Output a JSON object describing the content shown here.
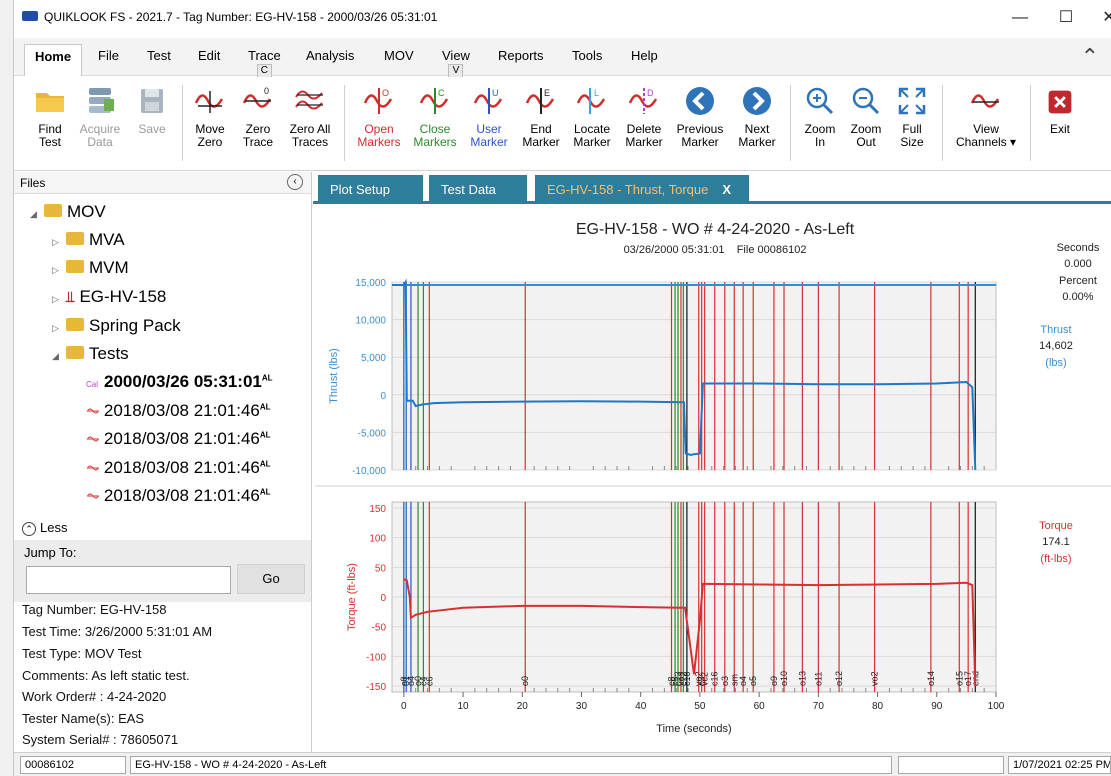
{
  "window": {
    "title": "QUIKLOOK FS - 2021.7 - Tag Number: EG-HV-158 - 2000/03/26 05:31:01",
    "minimize": "—",
    "maximize": "☐",
    "close": "✕"
  },
  "menu": {
    "home": "Home",
    "file": "File",
    "test": "Test",
    "edit": "Edit",
    "trace": "Trace",
    "trace_key": "C",
    "analysis": "Analysis",
    "mov": "MOV",
    "view": "View",
    "view_key": "V",
    "reports": "Reports",
    "tools": "Tools",
    "help": "Help"
  },
  "ribbon": {
    "find_test": "Find\nTest",
    "acquire_data": "Acquire\nData",
    "save": "Save",
    "move_zero": "Move\nZero",
    "zero_trace": "Zero\nTrace",
    "zero_all_traces": "Zero All\nTraces",
    "open_markers": "Open\nMarkers",
    "close_markers": "Close\nMarkers",
    "user_marker": "User\nMarker",
    "end_marker": "End\nMarker",
    "locate_marker": "Locate\nMarker",
    "delete_marker": "Delete\nMarker",
    "previous_marker": "Previous\nMarker",
    "next_marker": "Next\nMarker",
    "zoom_in": "Zoom\nIn",
    "zoom_out": "Zoom\nOut",
    "full_size": "Full\nSize",
    "view_channels": "View\nChannels ▾",
    "exit": "Exit",
    "colors": {
      "open": "#d22d2d",
      "close": "#2a8a2a",
      "user": "#2b52c8",
      "blue_btn": "#2f73b8",
      "exit": "#c0282e"
    }
  },
  "files": {
    "header": "Files",
    "mov": "MOV",
    "mva": "MVA",
    "mvm": "MVM",
    "valve": "EG-HV-158",
    "spring_pack": "Spring Pack",
    "tests": "Tests",
    "test_items": [
      {
        "label": "2000/03/26 05:31:01",
        "tag": "AL",
        "selected": true
      },
      {
        "label": "2018/03/08 21:01:46",
        "tag": "AL",
        "selected": false
      },
      {
        "label": "2018/03/08 21:01:46",
        "tag": "AL",
        "selected": false
      },
      {
        "label": "2018/03/08 21:01:46",
        "tag": "AL",
        "selected": false
      },
      {
        "label": "2018/03/08 21:01:46",
        "tag": "AL",
        "selected": false
      }
    ],
    "less": "Less",
    "jump_to": "Jump To:",
    "go": "Go",
    "info": {
      "tag_number": "Tag Number: EG-HV-158",
      "test_time": "Test Time: 3/26/2000 5:31:01 AM",
      "test_type": "Test Type: MOV Test",
      "comments": "Comments: As left static test.",
      "work_order": "Work Order# : 4-24-2020",
      "tester": "Tester Name(s): EAS",
      "serial": "System Serial# : 78605071"
    }
  },
  "tabs": {
    "plot_setup": "Plot Setup",
    "test_data": "Test Data",
    "active": "EG-HV-158 - Thrust, Torque",
    "close": "X"
  },
  "readout": {
    "seconds_label": "Seconds",
    "seconds_value": "0.000",
    "percent_label": "Percent",
    "percent_value": "0.00%",
    "thrust_label": "Thrust",
    "thrust_value": "14,602",
    "thrust_unit": "(lbs)",
    "torque_label": "Torque",
    "torque_value": "174.1",
    "torque_unit": "(ft-lbs)"
  },
  "chart_data": [
    {
      "type": "line",
      "title": "EG-HV-158 - WO # 4-24-2020 - As-Left",
      "subtitle": "03/26/2000 05:31:01    File 00086102",
      "ylabel": "Thrust  (lbs)",
      "ylim": [
        -10000,
        15000
      ],
      "yticks": [
        15000,
        10000,
        5000,
        0,
        -5000,
        -10000
      ],
      "ytick_labels": [
        "15,000",
        "10,000",
        "5,000",
        "0",
        "-5,000",
        "-10,000"
      ],
      "xlim": [
        -2,
        100
      ],
      "series": [
        {
          "color": "#1f77c8",
          "x": [
            -2,
            0,
            0.3,
            0.5,
            1.5,
            2,
            3,
            5,
            10,
            20,
            30,
            40,
            47,
            47.3,
            47.6,
            48.5,
            49,
            50,
            50.5,
            51,
            60,
            70,
            80,
            90,
            95,
            96,
            96.5
          ],
          "y": [
            14600,
            14600,
            15000,
            -800,
            -800,
            -1500,
            -1300,
            -1100,
            -1000,
            -900,
            -850,
            -900,
            -1000,
            -1000,
            -7800,
            -8000,
            -7900,
            -7800,
            1500,
            1500,
            1500,
            1400,
            1400,
            1500,
            1700,
            1000,
            -10000
          ]
        },
        {
          "color": "#2a8fd6",
          "x": [
            -2,
            100
          ],
          "y": [
            14600,
            14600
          ]
        }
      ]
    },
    {
      "type": "line",
      "ylabel": "Torque  (ft-lbs)",
      "xlabel": "Time  (seconds)",
      "ylim": [
        -160,
        160
      ],
      "yticks": [
        150,
        100,
        50,
        0,
        -50,
        -100,
        -150
      ],
      "xlim": [
        -2,
        100
      ],
      "xticks": [
        0,
        10,
        20,
        30,
        40,
        50,
        60,
        70,
        80,
        90,
        100
      ],
      "series": [
        {
          "color": "#d63030",
          "x": [
            0,
            0.5,
            1,
            1.2,
            2,
            4,
            10,
            20,
            30,
            40,
            47,
            47.5,
            49,
            50,
            50.5,
            51,
            60,
            70,
            80,
            90,
            95,
            96,
            96.5
          ],
          "y": [
            30,
            28,
            0,
            -35,
            -30,
            -25,
            -18,
            -15,
            -15,
            -17,
            -18,
            -18,
            -130,
            -40,
            22,
            22,
            21,
            20,
            21,
            22,
            24,
            20,
            -150
          ]
        }
      ],
      "markers": [
        {
          "x": 0,
          "label": "c0",
          "color": "#1a5cb8"
        },
        {
          "x": 0.4,
          "label": "o1",
          "color": "#1a5cb8"
        },
        {
          "x": 1.2,
          "label": "o4",
          "color": "#2b52c8"
        },
        {
          "x": 2.4,
          "label": "o0",
          "color": "#2a8a2a"
        },
        {
          "x": 3.3,
          "label": "c4",
          "color": "#2a8a2a"
        },
        {
          "x": 4.3,
          "label": "c6",
          "color": "#d63030"
        },
        {
          "x": 20.5,
          "label": "o0",
          "color": "#d63030"
        },
        {
          "x": 45.2,
          "label": "c8",
          "color": "#d63030"
        },
        {
          "x": 45.8,
          "label": "c5",
          "color": "#2a8a2a"
        },
        {
          "x": 46.3,
          "label": "c13",
          "color": "#2a8a2a"
        },
        {
          "x": 46.8,
          "label": "vo1",
          "color": "#d63030"
        },
        {
          "x": 47.2,
          "label": "c12",
          "color": "#2a8a2a"
        },
        {
          "x": 47.8,
          "label": "c10",
          "color": "#111111"
        },
        {
          "x": 49.8,
          "label": "vo2",
          "color": "#d63030"
        },
        {
          "x": 50.3,
          "label": "c3",
          "color": "#d63030"
        },
        {
          "x": 50.8,
          "label": "vc2",
          "color": "#d63030"
        },
        {
          "x": 52.5,
          "label": "c16",
          "color": "#d63030"
        },
        {
          "x": 54.2,
          "label": "o3",
          "color": "#d63030"
        },
        {
          "x": 55.8,
          "label": "sm",
          "color": "#d63030"
        },
        {
          "x": 57.3,
          "label": "o4",
          "color": "#d63030"
        },
        {
          "x": 59,
          "label": "o5",
          "color": "#d63030"
        },
        {
          "x": 62.5,
          "label": "o9",
          "color": "#d63030"
        },
        {
          "x": 64.2,
          "label": "o10",
          "color": "#d63030"
        },
        {
          "x": 67.3,
          "label": "o13",
          "color": "#d63030"
        },
        {
          "x": 70,
          "label": "o11",
          "color": "#d63030"
        },
        {
          "x": 73.5,
          "label": "o12",
          "color": "#d63030"
        },
        {
          "x": 79.5,
          "label": "vo2",
          "color": "#d63030"
        },
        {
          "x": 89,
          "label": "o14",
          "color": "#d63030"
        },
        {
          "x": 93.8,
          "label": "o15",
          "color": "#d63030"
        },
        {
          "x": 95.3,
          "label": "o17",
          "color": "#d63030"
        },
        {
          "x": 96.5,
          "label": "end",
          "color": "#111111"
        }
      ]
    }
  ],
  "status": {
    "file": "00086102",
    "description": "EG-HV-158 - WO # 4-24-2020 - As-Left",
    "datetime": "1/07/2021 02:25 PM"
  }
}
